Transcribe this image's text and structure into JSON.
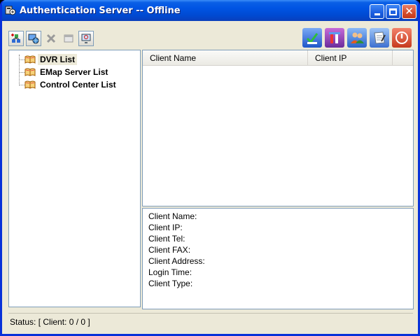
{
  "window": {
    "title": "Authentication Server -- Offline",
    "icons": {
      "app": "server-app-icon",
      "minimize": "minimize-icon",
      "maximize": "maximize-icon",
      "close": "close-icon"
    }
  },
  "toolbar_left": [
    {
      "id": "add-dvr",
      "icon": "add-network-icon"
    },
    {
      "id": "connect",
      "icon": "connect-globe-icon"
    },
    {
      "id": "delete",
      "icon": "delete-x-icon"
    },
    {
      "id": "properties",
      "icon": "window-properties-icon"
    },
    {
      "id": "search",
      "icon": "search-monitor-icon"
    }
  ],
  "toolbar_right": [
    {
      "id": "install",
      "icon": "install-check-icon"
    },
    {
      "id": "settings",
      "icon": "tools-settings-icon"
    },
    {
      "id": "users",
      "icon": "users-icon"
    },
    {
      "id": "notes",
      "icon": "notepad-icon"
    },
    {
      "id": "power",
      "icon": "power-exit-icon"
    }
  ],
  "tree": {
    "items": [
      {
        "label": "DVR List",
        "selected": true
      },
      {
        "label": "EMap Server List",
        "selected": false
      },
      {
        "label": "Control Center List",
        "selected": false
      }
    ]
  },
  "client_list": {
    "columns": [
      "Client Name",
      "Client IP"
    ]
  },
  "details": {
    "fields": [
      "Client Name:",
      "Client IP:",
      "Client Tel:",
      "Client FAX:",
      "Client Address:",
      "Login Time:",
      "Client Type:"
    ]
  },
  "status": {
    "text": "Status: [ Client: 0 / 0 ]"
  },
  "colors": {
    "titlebar": "#0054e3",
    "window_bg": "#ece9d8",
    "panel_border": "#7f9db9",
    "close_button": "#d44c2c"
  }
}
